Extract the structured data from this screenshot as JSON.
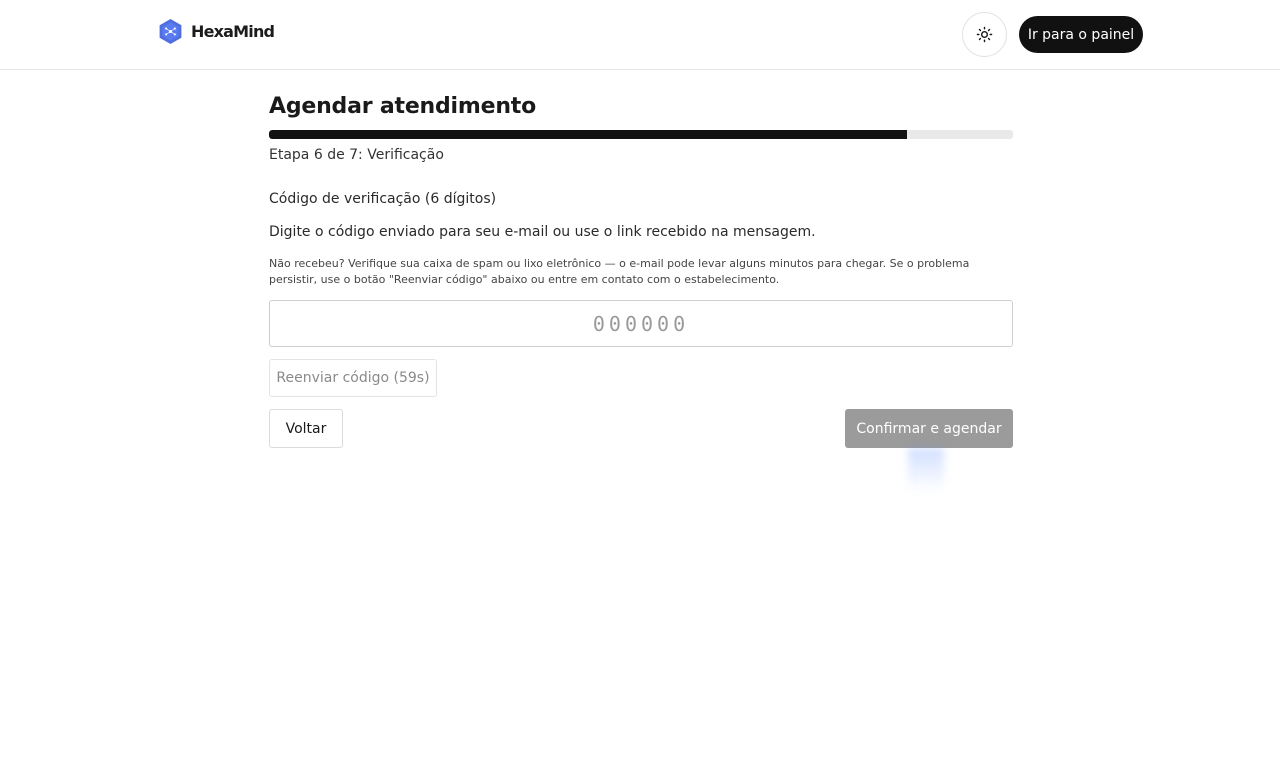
{
  "brand": {
    "name": "HexaMind",
    "logo_icon": "hexagon-logo-icon",
    "logo_color": "#4f6fe0"
  },
  "header": {
    "theme_toggle_icon": "sun-icon",
    "dashboard_button_label": "Ir para o painel"
  },
  "form": {
    "title": "Agendar atendimento",
    "progress": {
      "current_step": 6,
      "total_steps": 7,
      "fraction": 0.857
    },
    "step_text": "Etapa 6 de 7: Verificação",
    "code_label": "Código de verificação (6 dígitos)",
    "instruction": "Digite o código enviado para seu e-mail ou use o link recebido na mensagem.",
    "hint": "Não recebeu? Verifique sua caixa de spam ou lixo eletrônico — o e-mail pode levar alguns minutos para chegar. Se o problema persistir, use o botão \"Reenviar código\" abaixo ou entre em contato com o estabelecimento.",
    "code_input": {
      "value": "",
      "placeholder": "000000"
    },
    "resend_label": "Reenviar código (59s)",
    "back_label": "Voltar",
    "confirm_label": "Confirmar e agendar"
  },
  "colors": {
    "primary": "#111111",
    "progress_track": "#e9e9e9",
    "disabled_button": "#9b9b9b",
    "border": "#cfcfcf"
  }
}
